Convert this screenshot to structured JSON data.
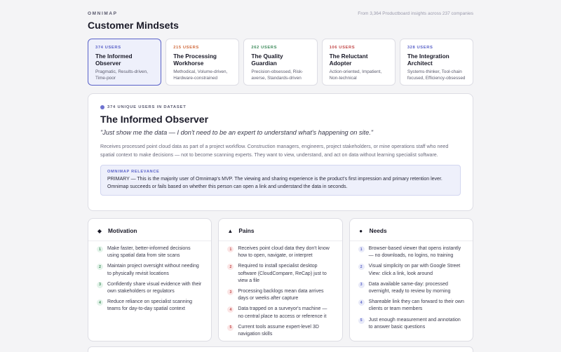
{
  "header": {
    "brand": "OMNIMAP",
    "source": "From 3,364 Productboard insights across 237 companies",
    "title": "Customer Mindsets"
  },
  "colors": {
    "accent": "#5a62c8",
    "card_users_1": "#5a62c8",
    "card_users_2": "#d06a3c",
    "card_users_3": "#3c8a5a",
    "card_users_4": "#c24848",
    "card_users_5": "#5a62c8"
  },
  "cards": [
    {
      "users": "374 USERS",
      "title": "The Informed Observer",
      "tags": "Pragmatic, Results-driven, Time-poor",
      "color": "#5a62c8"
    },
    {
      "users": "215 USERS",
      "title": "The Processing Workhorse",
      "tags": "Methodical, Volume-driven, Hardware-constrained",
      "color": "#d06a3c"
    },
    {
      "users": "262 USERS",
      "title": "The Quality Guardian",
      "tags": "Precision-obsessed, Risk-averse, Standards-driven",
      "color": "#3c8a5a"
    },
    {
      "users": "106 USERS",
      "title": "The Reluctant Adopter",
      "tags": "Action-oriented, Impatient, Non-technical",
      "color": "#c24848"
    },
    {
      "users": "328 USERS",
      "title": "The Integration Architect",
      "tags": "Systems-thinker, Tool-chain focused, Efficiency-obsessed",
      "color": "#5a62c8"
    }
  ],
  "detail": {
    "unique": "374 UNIQUE USERS IN DATASET",
    "title": "The Informed Observer",
    "quote": "\"Just show me the data — I don't need to be an expert to understand what's happening on site.\"",
    "description": "Receives processed point cloud data as part of a project workflow. Construction managers, engineers, project stakeholders, or mine operations staff who need spatial context to make decisions — not to become scanning experts. They want to view, understand, and act on data without learning specialist software.",
    "relevance_label": "OMNIMAP RELEVANCE",
    "relevance_text": "PRIMARY — This is the majority user of Omnimap's MVP. The viewing and sharing experience is the product's first impression and primary retention lever. Omnimap succeeds or fails based on whether this person can open a link and understand the data in seconds."
  },
  "columns": [
    {
      "key": "motivation",
      "title": "Motivation",
      "icon": "diamond-icon",
      "glyph": "◆",
      "items": [
        "Make faster, better-informed decisions using spatial data from site scans",
        "Maintain project oversight without needing to physically revisit locations",
        "Confidently share visual evidence with their own stakeholders or regulators",
        "Reduce reliance on specialist scanning teams for day-to-day spatial context"
      ]
    },
    {
      "key": "pains",
      "title": "Pains",
      "icon": "triangle-icon",
      "glyph": "▲",
      "items": [
        "Receives point cloud data they don't know how to open, navigate, or interpret",
        "Required to install specialist desktop software (CloudCompare, ReCap) just to view a file",
        "Processing backlogs mean data arrives days or weeks after capture",
        "Data trapped on a surveyor's machine — no central place to access or reference it",
        "Current tools assume expert-level 3D navigation skills"
      ]
    },
    {
      "key": "needs",
      "title": "Needs",
      "icon": "circle-icon",
      "glyph": "●",
      "items": [
        "Browser-based viewer that opens instantly — no downloads, no logins, no training",
        "Visual simplicity on par with Google Street View: click a link, look around",
        "Data available same-day: processed overnight, ready to review by morning",
        "Shareable link they can forward to their own clients or team members",
        "Just enough measurement and annotation to answer basic questions"
      ]
    }
  ]
}
